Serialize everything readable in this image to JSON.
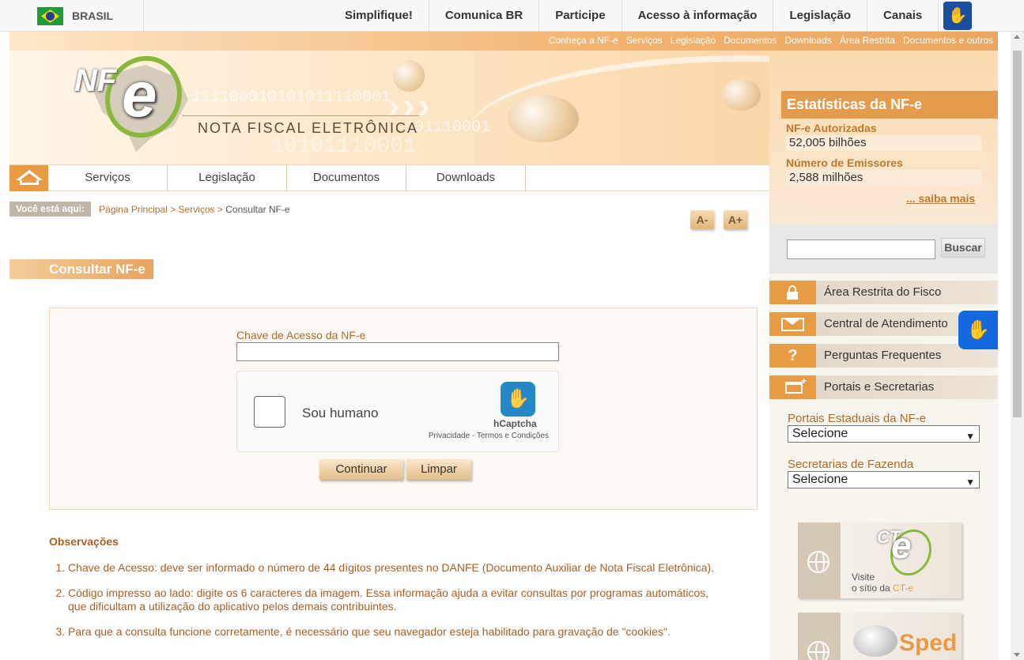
{
  "gov_bar": {
    "country": "BRASIL",
    "links": [
      "Simplifique!",
      "Comunica BR",
      "Participe",
      "Acesso à informação",
      "Legislação",
      "Canais"
    ]
  },
  "header": {
    "top_links": [
      "Conheça a NF-e",
      "Serviços",
      "Legislação",
      "Documentos",
      "Downloads",
      "Área Restrita",
      "Documentos e outros"
    ],
    "logo_nf": "NF",
    "logo_e": "e",
    "brand": "NOTA FISCAL ELETRÔNICA",
    "binary_1": "111100010101011110001",
    "binary_2": "101110001",
    "binary_3": "10101110001"
  },
  "nav": {
    "items": [
      "Serviços",
      "Legislação",
      "Documentos",
      "Downloads"
    ]
  },
  "breadcrumb": {
    "label": "Você está aqui:",
    "path_1": "Página Principal",
    "sep": " > ",
    "path_2": "Serviços",
    "current": "Consultar NF-e"
  },
  "font_controls": {
    "decrease": "A-",
    "increase": "A+"
  },
  "page_title": "Consultar NF-e",
  "form": {
    "access_key_label": "Chave de Acesso da NF-e",
    "access_key_value": "",
    "captcha_text": "Sou humano",
    "captcha_brand": "hCaptcha",
    "captcha_legal": "Privacidade - Termos e Condições",
    "continue_label": "Continuar",
    "clear_label": "Limpar"
  },
  "observations": {
    "title": "Observações",
    "items": [
      "Chave de Acesso: deve ser informado o número de 44 dígitos presentes no DANFE (Documento Auxiliar de Nota Fiscal Eletrônica).",
      "Código impresso ao lado: digite os 6 caracteres da imagem. Essa informação ajuda a evitar consultas por programas automáticos, que dificultam a utilização do aplicativo pelos demais contribuintes.",
      "Para que a consulta funcione corretamente, é necessário que seu navegador esteja habilitado para gravação de \"cookies\"."
    ]
  },
  "stats": {
    "title": "Estatísticas da NF-e",
    "authorized_label": "NF-e Autorizadas",
    "authorized_value": "52,005 bilhões",
    "emitters_label": "Número de Emissores",
    "emitters_value": "2,588 milhões",
    "more": "... saiba mais"
  },
  "search": {
    "value": "",
    "button": "Buscar"
  },
  "side_links": [
    "Área Restrita do Fisco",
    "Central de Atendimento",
    "Perguntas Frequentes",
    "Portais e Secretarias"
  ],
  "portais": {
    "states_label": "Portais Estaduais da NF-e",
    "states_selected": "Selecione",
    "treasury_label": "Secretarias de Fazenda",
    "treasury_selected": "Selecione"
  },
  "banners": {
    "cte_logo": "CT",
    "cte_e": "e",
    "cte_visit_1": "Visite",
    "cte_visit_2": "o sítio da ",
    "cte_visit_3": "CT-e",
    "sped": "Sped"
  },
  "icons": {
    "help": "?",
    "vlibras": "hands-icon",
    "accent": "#e89a45"
  }
}
